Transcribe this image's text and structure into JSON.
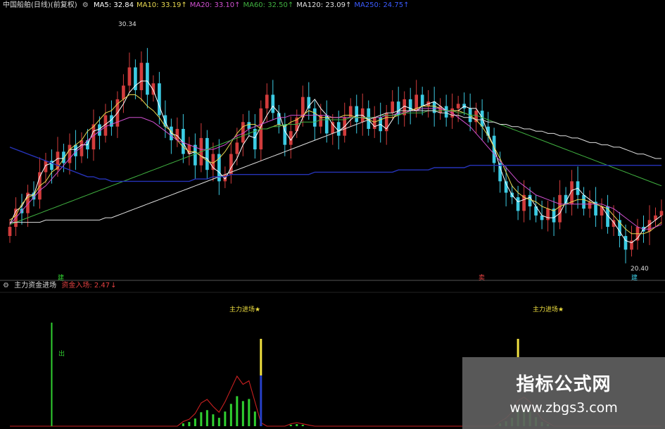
{
  "colors": {
    "up": "#d23c3c",
    "down": "#3ccbe3",
    "ma5": "#ffffff",
    "ma10": "#e8d850",
    "ma20": "#d050d0",
    "ma60": "#40b040",
    "ma120": "#e0e0e0",
    "ma250": "#2633b8",
    "flow": "#c82020",
    "bar_green": "#30d030",
    "bar_yellow": "#f0e040",
    "bar_blue": "#2640c8"
  },
  "top_panel": {
    "title": "中国船舶(日线)(前复权)",
    "legend": [
      {
        "label": "MA5: 32.84",
        "color": "#ffffff"
      },
      {
        "label": "MA10: 33.19↑",
        "color": "#e8d850"
      },
      {
        "label": "MA20: 33.10↑",
        "color": "#d050d0"
      },
      {
        "label": "MA60: 32.50↑",
        "color": "#40b040"
      },
      {
        "label": "MA120: 23.09↑",
        "color": "#e0e0e0"
      },
      {
        "label": "MA250: 24.75↑",
        "color": "#3b5bff"
      }
    ],
    "high_label": "30.34",
    "low_label": "20.40",
    "buy_marker": "建",
    "sell_marker": "卖",
    "low_marker": "建"
  },
  "bottom_panel": {
    "title": "主力资金进场",
    "indicator_label": "资金入场: 2.47",
    "indicator_arrow": "↓",
    "signals": [
      "主力进场★",
      "主力进场★"
    ],
    "side_mark": "出"
  },
  "watermark": {
    "title": "指标公式网",
    "url": "www.zbgs3.com"
  },
  "chart_data": [
    {
      "type": "candlestick",
      "title": "中国船舶(日线)(前复权)",
      "ylim": [
        19.5,
        31.0
      ],
      "annotations": [
        "30.34",
        "20.40"
      ],
      "series": [
        {
          "name": "MA5",
          "values": [
            21.7,
            22.3,
            22.5,
            23.0,
            23.0,
            23.8,
            24.3,
            24.4,
            24.6,
            24.6,
            25.0,
            25.0,
            25.2,
            25.2,
            25.8,
            25.9,
            26.1,
            26.3,
            26.6,
            27.0,
            27.5,
            27.8,
            28.0,
            28.0,
            27.6,
            26.9,
            26.2,
            25.7,
            25.6,
            25.3,
            24.8,
            24.9,
            24.7,
            24.6,
            24.2,
            24.0,
            23.7,
            24.2,
            24.6,
            25.2,
            25.6,
            25.5,
            26.0,
            26.5,
            26.9,
            26.6,
            25.8,
            25.4,
            25.8,
            26.4,
            26.9,
            27.2,
            26.8,
            26.5,
            26.1,
            25.8,
            26.0,
            26.3,
            26.5,
            26.5,
            26.3,
            26.0,
            26.1,
            25.9,
            26.3,
            26.7,
            26.9,
            26.8,
            26.7,
            26.9,
            27.0,
            27.1,
            26.9,
            26.7,
            26.7,
            26.7,
            26.9,
            26.8,
            26.8,
            26.4,
            25.7,
            25.1,
            24.2,
            23.5,
            23.0,
            22.7,
            22.8,
            22.9,
            22.5,
            22.1,
            22.0,
            22.0,
            22.2,
            22.7,
            23.2,
            23.3,
            23.0,
            22.8,
            22.6,
            22.5,
            22.1,
            21.8,
            21.4,
            21.0,
            20.9,
            21.1,
            21.5,
            21.7,
            21.9,
            22.1
          ]
        },
        {
          "name": "MA10",
          "values": [
            21.9,
            22.1,
            22.6,
            22.9,
            23.0,
            23.4,
            23.6,
            24.0,
            24.2,
            24.6,
            25.0,
            25.2,
            25.4,
            25.8,
            26.0,
            26.3,
            26.6,
            26.7,
            27.0,
            27.2,
            27.4,
            27.4,
            27.2,
            26.9,
            26.7,
            26.4,
            26.0,
            25.8,
            25.4,
            25.1,
            24.9,
            24.9,
            24.7,
            24.5,
            24.4,
            24.6,
            24.9,
            25.3,
            25.7,
            26.0,
            26.1,
            26.1,
            25.9,
            25.9,
            26.0,
            26.1,
            26.0,
            26.2,
            26.3,
            26.5,
            26.7,
            26.6,
            26.4,
            26.4,
            26.4,
            26.4,
            26.5,
            26.5,
            26.4,
            26.4,
            26.3,
            26.2,
            26.3,
            26.4,
            26.4,
            26.5,
            26.6,
            26.7,
            26.8,
            26.9,
            26.9,
            26.9,
            26.8,
            26.7,
            26.7,
            26.7,
            26.6,
            26.5,
            26.3,
            26.0,
            25.6,
            25.1,
            24.6,
            24.0,
            23.4,
            23.1,
            22.9,
            22.8,
            22.7,
            22.5,
            22.4,
            22.3,
            22.5,
            22.6,
            22.7,
            22.8,
            22.8,
            22.7,
            22.6,
            22.5,
            22.4,
            22.1,
            21.8,
            21.5,
            21.3,
            21.3,
            21.3,
            21.4,
            21.6,
            21.8
          ]
        },
        {
          "name": "MA20",
          "values": [
            21.7,
            22.0,
            22.3,
            22.6,
            22.9,
            23.2,
            23.4,
            23.7,
            24.0,
            24.3,
            24.6,
            24.9,
            25.1,
            25.4,
            25.6,
            25.8,
            26.0,
            26.1,
            26.2,
            26.3,
            26.4,
            26.4,
            26.4,
            26.3,
            26.2,
            26.0,
            25.8,
            25.6,
            25.4,
            25.3,
            25.2,
            25.1,
            25.0,
            25.0,
            25.0,
            25.1,
            25.2,
            25.4,
            25.6,
            25.7,
            25.9,
            26.0,
            26.1,
            26.2,
            26.3,
            26.4,
            26.4,
            26.5,
            26.5,
            26.5,
            26.5,
            26.5,
            26.5,
            26.5,
            26.4,
            26.4,
            26.4,
            26.4,
            26.4,
            26.4,
            26.4,
            26.4,
            26.4,
            26.5,
            26.5,
            26.6,
            26.6,
            26.7,
            26.7,
            26.8,
            26.8,
            26.8,
            26.8,
            26.7,
            26.6,
            26.4,
            26.2,
            26.0,
            25.7,
            25.4,
            25.1,
            24.8,
            24.5,
            24.2,
            23.9,
            23.6,
            23.4,
            23.2,
            23.0,
            22.9,
            22.8,
            22.7,
            22.6,
            22.6,
            22.6,
            22.6,
            22.6,
            22.6,
            22.6,
            22.6,
            22.5,
            22.4,
            22.2,
            22.0,
            21.8,
            21.6,
            21.5,
            21.5,
            21.6,
            21.7
          ]
        },
        {
          "name": "MA60",
          "values": [
            21.7,
            21.8,
            21.9,
            22.0,
            22.1,
            22.2,
            22.3,
            22.4,
            22.5,
            22.6,
            22.7,
            22.8,
            22.9,
            23.0,
            23.1,
            23.2,
            23.3,
            23.4,
            23.5,
            23.6,
            23.7,
            23.8,
            23.9,
            24.0,
            24.1,
            24.2,
            24.3,
            24.4,
            24.5,
            24.6,
            24.7,
            24.8,
            24.9,
            25.0,
            25.1,
            25.2,
            25.3,
            25.4,
            25.5,
            25.6,
            25.7,
            25.8,
            25.9,
            25.9,
            26.0,
            26.0,
            26.1,
            26.1,
            26.1,
            26.2,
            26.2,
            26.2,
            26.3,
            26.3,
            26.3,
            26.3,
            26.3,
            26.4,
            26.4,
            26.4,
            26.4,
            26.4,
            26.5,
            26.5,
            26.5,
            26.5,
            26.6,
            26.6,
            26.6,
            26.6,
            26.7,
            26.7,
            26.7,
            26.7,
            26.7,
            26.6,
            26.6,
            26.5,
            26.5,
            26.4,
            26.3,
            26.2,
            26.1,
            26.0,
            25.9,
            25.8,
            25.7,
            25.6,
            25.5,
            25.4,
            25.3,
            25.2,
            25.1,
            25.0,
            24.9,
            24.8,
            24.7,
            24.6,
            24.5,
            24.4,
            24.3,
            24.2,
            24.1,
            24.0,
            23.9,
            23.8,
            23.7,
            23.6,
            23.5,
            23.4
          ]
        },
        {
          "name": "MA120",
          "values": [
            21.8,
            21.8,
            21.8,
            21.8,
            21.8,
            21.8,
            21.9,
            21.9,
            21.9,
            21.9,
            21.9,
            21.9,
            21.9,
            21.9,
            21.9,
            21.9,
            22.0,
            22.0,
            22.1,
            22.2,
            22.3,
            22.4,
            22.5,
            22.6,
            22.7,
            22.8,
            22.9,
            23.0,
            23.1,
            23.2,
            23.3,
            23.4,
            23.5,
            23.6,
            23.7,
            23.8,
            23.9,
            24.0,
            24.1,
            24.2,
            24.3,
            24.4,
            24.5,
            24.6,
            24.7,
            24.8,
            24.9,
            25.0,
            25.1,
            25.2,
            25.3,
            25.4,
            25.5,
            25.6,
            25.7,
            25.8,
            25.9,
            26.0,
            26.1,
            26.2,
            26.3,
            26.4,
            26.5,
            26.6,
            26.6,
            26.7,
            26.7,
            26.7,
            26.7,
            26.7,
            26.7,
            26.7,
            26.6,
            26.6,
            26.5,
            26.5,
            26.4,
            26.4,
            26.3,
            26.3,
            26.2,
            26.2,
            26.1,
            26.1,
            26.0,
            26.0,
            25.9,
            25.9,
            25.8,
            25.8,
            25.7,
            25.7,
            25.6,
            25.6,
            25.5,
            25.5,
            25.4,
            25.3,
            25.3,
            25.2,
            25.2,
            25.1,
            25.1,
            25.0,
            24.9,
            24.8,
            24.8,
            24.7,
            24.6,
            24.6
          ]
        },
        {
          "name": "MA250",
          "values": [
            25.1,
            25.0,
            24.9,
            24.8,
            24.7,
            24.6,
            24.5,
            24.4,
            24.3,
            24.2,
            24.1,
            24.0,
            23.9,
            23.8,
            23.8,
            23.7,
            23.7,
            23.6,
            23.6,
            23.6,
            23.6,
            23.6,
            23.6,
            23.6,
            23.6,
            23.6,
            23.6,
            23.6,
            23.6,
            23.6,
            23.6,
            23.7,
            23.7,
            23.7,
            23.8,
            23.8,
            23.8,
            23.9,
            23.9,
            23.9,
            23.9,
            23.9,
            23.9,
            23.9,
            23.9,
            23.9,
            23.9,
            23.9,
            23.9,
            23.9,
            23.9,
            24.0,
            24.0,
            24.0,
            24.0,
            24.0,
            24.0,
            24.0,
            24.0,
            24.0,
            24.0,
            24.0,
            24.0,
            24.0,
            24.0,
            24.1,
            24.1,
            24.1,
            24.1,
            24.1,
            24.1,
            24.2,
            24.2,
            24.2,
            24.2,
            24.2,
            24.2,
            24.3,
            24.3,
            24.3,
            24.3,
            24.3,
            24.3,
            24.3,
            24.3,
            24.3,
            24.3,
            24.3,
            24.3,
            24.3,
            24.3,
            24.3,
            24.3,
            24.3,
            24.3,
            24.3,
            24.3,
            24.3,
            24.3,
            24.3,
            24.3,
            24.3,
            24.3,
            24.3,
            24.3,
            24.3,
            24.3,
            24.3,
            24.3,
            24.3
          ]
        }
      ],
      "close": [
        21.6,
        22.4,
        22.2,
        23.1,
        22.8,
        24.0,
        24.5,
        24.1,
        24.9,
        24.4,
        25.2,
        24.7,
        25.4,
        25.0,
        26.1,
        25.6,
        26.5,
        26.0,
        27.2,
        27.8,
        28.6,
        27.6,
        28.8,
        27.4,
        27.9,
        26.5,
        26.0,
        25.4,
        25.9,
        24.8,
        25.2,
        24.3,
        25.5,
        24.1,
        24.8,
        23.6,
        23.9,
        24.8,
        25.3,
        26.2,
        25.9,
        25.0,
        26.8,
        27.4,
        26.6,
        26.1,
        25.2,
        25.8,
        26.4,
        27.3,
        26.8,
        26.0,
        26.5,
        25.7,
        26.2,
        25.6,
        26.4,
        26.9,
        26.2,
        26.8,
        25.9,
        26.4,
        25.8,
        26.6,
        27.1,
        26.5,
        27.2,
        26.7,
        27.4,
        26.9,
        27.1,
        26.6,
        26.9,
        26.4,
        26.8,
        27.0,
        26.8,
        26.2,
        26.7,
        26.0,
        25.6,
        24.4,
        23.6,
        23.1,
        22.9,
        22.3,
        23.0,
        22.5,
        22.1,
        21.9,
        22.4,
        21.8,
        23.0,
        22.6,
        23.6,
        23.0,
        22.4,
        22.7,
        22.1,
        22.5,
        21.6,
        21.9,
        21.2,
        20.6,
        21.0,
        21.6,
        21.4,
        21.9,
        22.1,
        22.3
      ]
    },
    {
      "type": "bar",
      "title": "主力资金进场",
      "series": [
        {
          "name": "资金入场",
          "values": [
            0.0,
            0.0,
            0.0,
            0.0,
            0.0,
            0.0,
            0.0,
            0.0,
            0.0,
            0.0,
            0.0,
            0.0,
            0.0,
            0.0,
            0.0,
            0.0,
            0.0,
            0.0,
            0.0,
            0.0,
            0.0,
            0.0,
            0.0,
            0.0,
            0.0,
            0.0,
            0.0,
            0.0,
            0.0,
            0.4,
            0.6,
            1.1,
            2.0,
            2.3,
            1.7,
            1.2,
            2.1,
            3.2,
            4.3,
            3.6,
            3.9,
            2.1,
            0.3,
            0.0,
            0.0,
            0.0,
            0.0,
            0.2,
            0.3,
            0.2,
            0.1,
            0.0,
            0.0,
            0.0,
            0.0,
            0.0,
            0.0,
            0.0,
            0.0,
            0.0,
            0.0,
            0.0,
            0.0,
            0.0,
            0.0,
            0.0,
            0.0,
            0.0,
            0.0,
            0.0,
            0.0,
            0.0,
            0.0,
            0.0,
            0.0,
            0.0,
            0.0,
            0.0,
            0.0,
            0.0,
            0.0,
            0.0,
            0.4,
            0.7,
            1.2,
            2.2,
            2.5,
            2.1,
            1.3,
            0.6,
            0.3,
            0.0,
            0.0,
            0.0,
            0.0,
            0.0,
            0.0,
            0.0,
            0.0,
            0.0,
            0.0,
            0.0,
            0.0,
            0.0,
            0.0,
            0.0,
            0.0,
            0.0,
            0.0,
            0.0
          ]
        }
      ],
      "annotations": [
        "主力进场★",
        "主力进场★",
        "出"
      ]
    }
  ]
}
